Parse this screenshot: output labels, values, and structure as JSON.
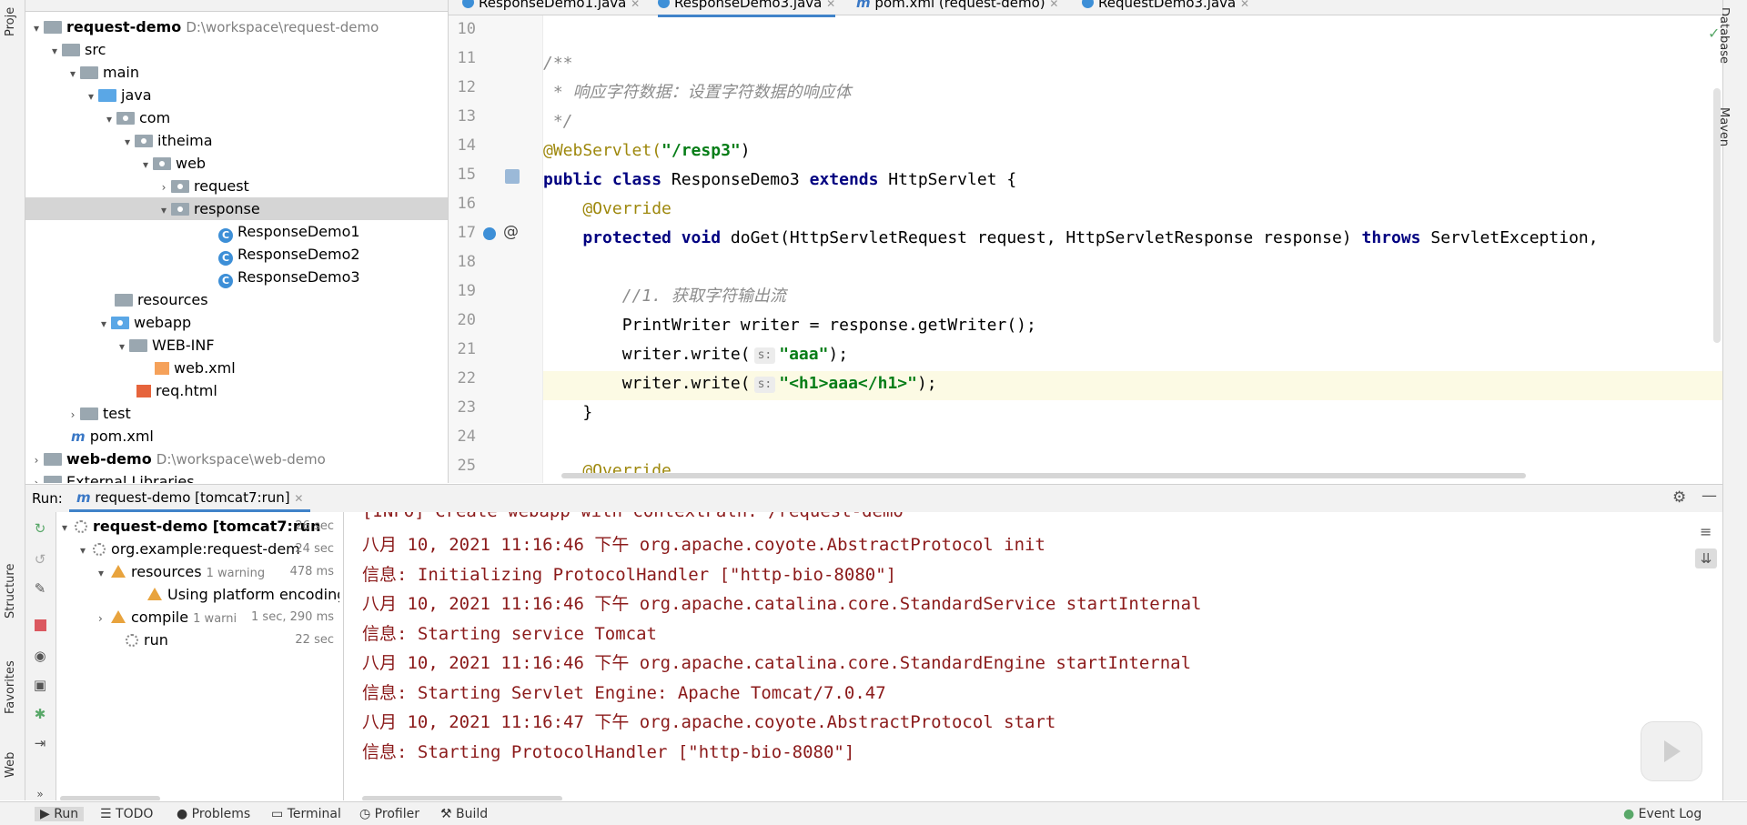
{
  "left_strip": {
    "labels": [
      "Proje",
      "Structure",
      "Favorites",
      "Web"
    ]
  },
  "right_strip": {
    "labels": [
      "Database",
      "Maven"
    ]
  },
  "project_panel": {
    "header": "Project",
    "rows": [
      {
        "label": "request-demo",
        "path": "D:\\workspace\\request-demo"
      },
      {
        "label": "src"
      },
      {
        "label": "main"
      },
      {
        "label": "java"
      },
      {
        "label": "com"
      },
      {
        "label": "itheima"
      },
      {
        "label": "web"
      },
      {
        "label": "request"
      },
      {
        "label": "response"
      },
      {
        "label": "ResponseDemo1"
      },
      {
        "label": "ResponseDemo2"
      },
      {
        "label": "ResponseDemo3"
      },
      {
        "label": "resources"
      },
      {
        "label": "webapp"
      },
      {
        "label": "WEB-INF"
      },
      {
        "label": "web.xml"
      },
      {
        "label": "req.html"
      },
      {
        "label": "test"
      },
      {
        "label": "pom.xml"
      },
      {
        "label": "web-demo",
        "path": "D:\\workspace\\web-demo"
      },
      {
        "label": "External Libraries"
      }
    ]
  },
  "editor": {
    "tabs": [
      "ResponseDemo1.java",
      "ResponseDemo3.java",
      "pom.xml (request-demo)",
      "RequestDemo3.java"
    ],
    "line_numbers": [
      "10",
      "11",
      "12",
      "13",
      "14",
      "15",
      "16",
      "17",
      "18",
      "19",
      "20",
      "21",
      "22",
      "23",
      "24",
      "25"
    ],
    "code": {
      "l11": "/**",
      "l12": " * 响应字符数据：设置字符数据的响应体",
      "l13": " */",
      "l14_annot": "@WebServlet(",
      "l14_str": "\"/resp3\"",
      "l14_end": ")",
      "l15_kw1": "public class",
      "l15_name": " ResponseDemo3 ",
      "l15_kw2": "extends",
      "l15_rest": " HttpServlet {",
      "l16": "    @Override",
      "l17_kw": "    protected void",
      "l17_mid": " doGet(HttpServletRequest request, HttpServletResponse response) ",
      "l17_kw2": "throws",
      "l17_rest": " ServletException,",
      "l19": "        //1. 获取字符输出流",
      "l20": "        PrintWriter writer = response.getWriter();",
      "l21_a": "        writer.write(",
      "l21_hint": "s:",
      "l21_str": "\"aaa\"",
      "l21_end": ");",
      "l22_a": "        writer.write(",
      "l22_hint": "s:",
      "l22_str": "\"<h1>aaa</h1>\"",
      "l22_end": ");",
      "l23": "    }",
      "l25": "    @Override"
    }
  },
  "run_panel": {
    "label": "Run:",
    "tab": "request-demo [tomcat7:run]",
    "tree": [
      {
        "label": "request-demo [tomcat7:run",
        "time": "26 sec"
      },
      {
        "label": "org.example:request-dem",
        "time": "24 sec"
      },
      {
        "label": "resources",
        "extra": "1 warning",
        "time": "478 ms"
      },
      {
        "label": "Using platform encoding ("
      },
      {
        "label": "compile",
        "extra": "1 warni",
        "time": "1 sec, 290 ms"
      },
      {
        "label": "run",
        "time": "22 sec"
      }
    ],
    "console": [
      "[INFO] Create webapp with contextPath: /request-demo",
      "八月 10, 2021 11:16:46 下午 org.apache.coyote.AbstractProtocol init",
      "信息: Initializing ProtocolHandler [\"http-bio-8080\"]",
      "八月 10, 2021 11:16:46 下午 org.apache.catalina.core.StandardService startInternal",
      "信息: Starting service Tomcat",
      "八月 10, 2021 11:16:46 下午 org.apache.catalina.core.StandardEngine startInternal",
      "信息: Starting Servlet Engine: Apache Tomcat/7.0.47",
      "八月 10, 2021 11:16:47 下午 org.apache.coyote.AbstractProtocol start",
      "信息: Starting ProtocolHandler [\"http-bio-8080\"]"
    ]
  },
  "bottom_bar": {
    "items": [
      "Run",
      "TODO",
      "Problems",
      "Terminal",
      "Profiler",
      "Build"
    ],
    "event_log": "Event Log"
  }
}
